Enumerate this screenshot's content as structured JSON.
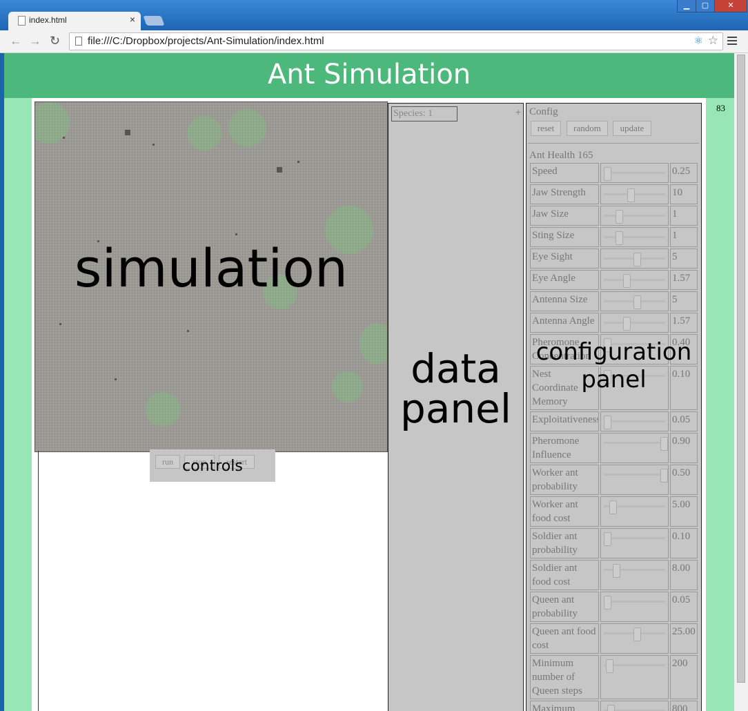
{
  "browser": {
    "tab_title": "index.html",
    "url": "file:///C:/Dropbox/projects/Ant-Simulation/index.html",
    "window_controls": [
      "minimize",
      "maximize",
      "close"
    ]
  },
  "page": {
    "title": "Ant Simulation",
    "counter": "83"
  },
  "simulation": {
    "label": "simulation"
  },
  "controls": {
    "label": "controls",
    "run": "run",
    "stop": "stop",
    "restart": "restart"
  },
  "data_panel": {
    "label_line1": "data",
    "label_line2": "panel",
    "species": "Species: 1",
    "add_icon": "+"
  },
  "config": {
    "title": "Config",
    "reset": "reset",
    "random": "random",
    "update": "update",
    "ant_health": "Ant Health 165",
    "label_line1": "configuration",
    "label_line2": "panel",
    "params": [
      {
        "name": "Speed",
        "value": "0.25",
        "pos": 0.02
      },
      {
        "name": "Jaw Strength",
        "value": "10",
        "pos": 0.42
      },
      {
        "name": "Jaw Size",
        "value": "1",
        "pos": 0.22
      },
      {
        "name": "Sting Size",
        "value": "1",
        "pos": 0.22
      },
      {
        "name": "Eye Sight",
        "value": "5",
        "pos": 0.52
      },
      {
        "name": "Eye Angle",
        "value": "1.57",
        "pos": 0.35
      },
      {
        "name": "Antenna Size",
        "value": "5",
        "pos": 0.52
      },
      {
        "name": "Antenna Angle",
        "value": "1.57",
        "pos": 0.35
      },
      {
        "name": "Pheromone Concentration",
        "value": "0.40",
        "pos": 0.02
      },
      {
        "name": "Nest Coordinate Memory",
        "value": "0.10",
        "pos": 0.02
      },
      {
        "name": "Exploitativeness",
        "value": "0.05",
        "pos": 0.02
      },
      {
        "name": "Pheromone Influence",
        "value": "0.90",
        "pos": 0.98
      },
      {
        "name": "Worker ant probability",
        "value": "0.50",
        "pos": 0.98
      },
      {
        "name": "Worker ant food cost",
        "value": "5.00",
        "pos": 0.12
      },
      {
        "name": "Soldier ant probability",
        "value": "0.10",
        "pos": 0.02
      },
      {
        "name": "Soldier ant food cost",
        "value": "8.00",
        "pos": 0.18
      },
      {
        "name": "Queen ant probability",
        "value": "0.05",
        "pos": 0.02
      },
      {
        "name": "Queen ant food cost",
        "value": "25.00",
        "pos": 0.52
      },
      {
        "name": "Minimum number of Queen steps",
        "value": "200",
        "pos": 0.06
      },
      {
        "name": "Maximum",
        "value": "800",
        "pos": 0.08
      }
    ]
  }
}
